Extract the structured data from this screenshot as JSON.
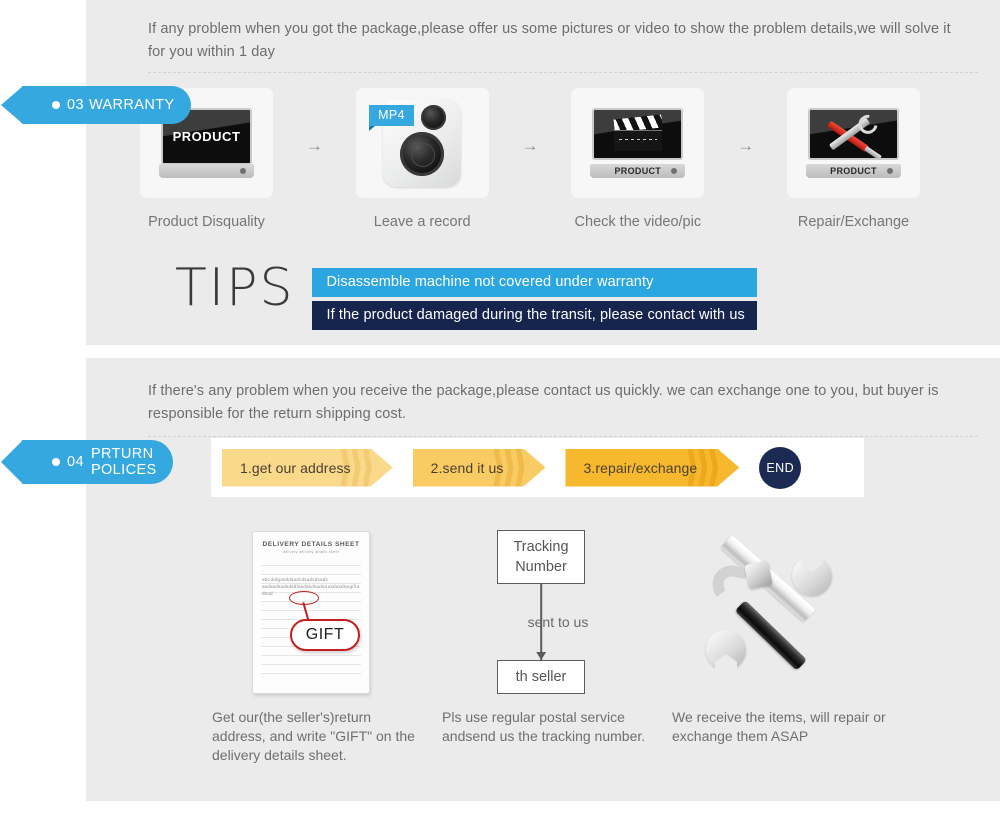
{
  "warranty_section": {
    "badge": {
      "number": "03",
      "label": "WARRANTY",
      "dot": "bullet-dot"
    },
    "intro": "If any problem when you got the package,please offer us some pictures or video to show the problem details,we will solve it for you within 1 day",
    "steps": [
      {
        "label": "Product Disquality",
        "icon": "monitor-product-icon",
        "screen_text": "PRODUCT"
      },
      {
        "label": "Leave a record",
        "icon": "camera-mp4-icon",
        "ribbon": "MP4"
      },
      {
        "label": "Check the video/pic",
        "icon": "monitor-clapperboard-icon",
        "base_text": "PRODUCT"
      },
      {
        "label": "Repair/Exchange",
        "icon": "monitor-tools-icon",
        "base_text": "PRODUCT"
      }
    ],
    "step_arrow": "→",
    "tips": {
      "heading": "TIPS",
      "bars": [
        "Disassemble machine not covered under warranty",
        "If the product damaged during the transit, please contact with us"
      ]
    }
  },
  "return_section": {
    "badge": {
      "number": "04",
      "line1": "PRTURN",
      "line2": "POLICES",
      "dot": "bullet-dot"
    },
    "intro": "If  there's any problem when you receive the package,please contact us quickly. we can exchange one to you, but buyer is responsible for the return shipping cost.",
    "flow": {
      "steps": [
        "1.get our address",
        "2.send it us",
        "3.repair/exchange"
      ],
      "end_label": "END"
    },
    "columns": [
      {
        "art": "delivery-details-sheet",
        "sheet_title": "DELIVERY DETAILS SHEET",
        "sheet_subtitle": "delivery          delivery details sheet",
        "sheet_body": "abc dafgasddsadcdsadsdsads asdasdsadsdsdfasdasdsadsa asdasdsa gift a dsad",
        "callout": "GIFT",
        "caption": "Get our(the seller's)return address, and write \"GIFT\" on the delivery details sheet."
      },
      {
        "art": "tracking-number-flow",
        "box_top": "Tracking Number",
        "mid_label": "sent to us",
        "box_bottom": "th seller",
        "caption": "Pls use regular postal service andsend us the tracking number."
      },
      {
        "art": "hammer-wrench-tools",
        "caption": "We receive the items, will repair or exchange them ASAP"
      }
    ]
  },
  "colors": {
    "panel_bg": "#ebebeb",
    "badge_blue": "#35a8e0",
    "tip_bar_blue": "#2ca6e0",
    "tip_bar_navy": "#15254d",
    "chev_light": "#fad98b",
    "chev_mid": "#f9cb63",
    "chev_dark": "#f7b82e",
    "end_navy": "#1b2a52",
    "text_gray": "#6d6d6d",
    "gift_red": "#c41f1f"
  }
}
